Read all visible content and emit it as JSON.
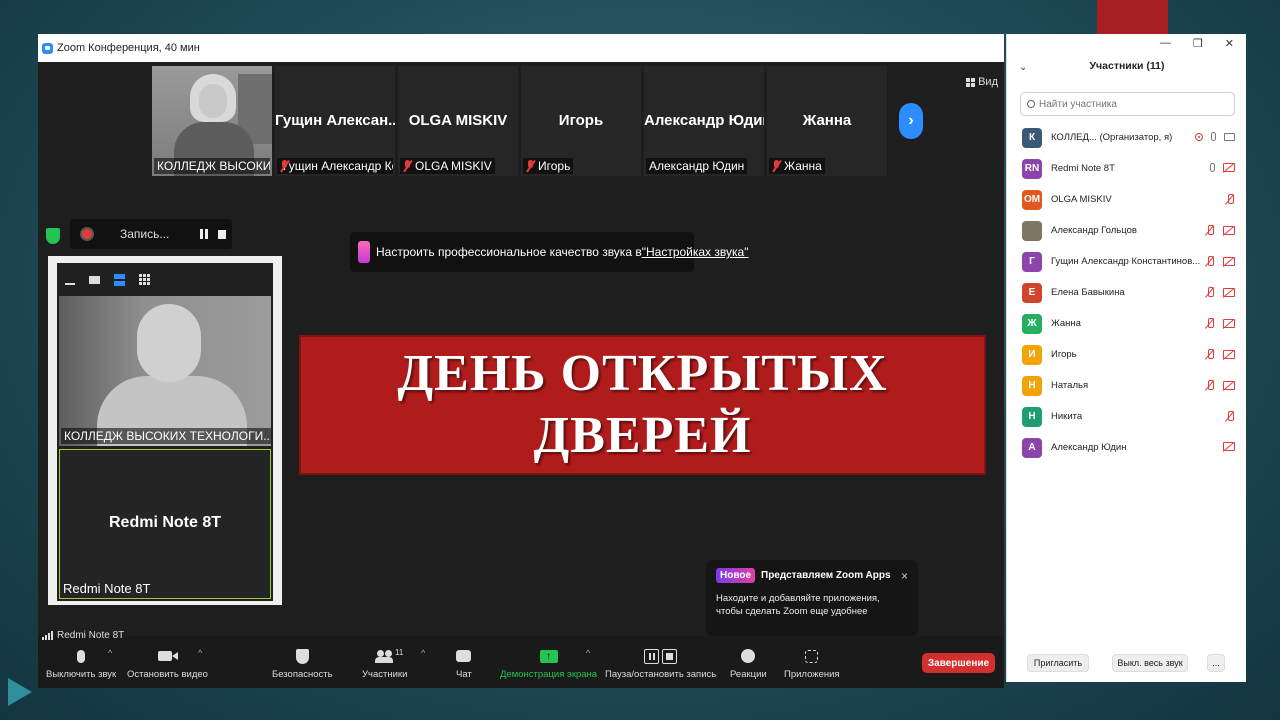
{
  "window": {
    "title": "Zoom Конференция, 40 мин"
  },
  "gallery": {
    "tiles": [
      {
        "label": "КОЛЛЕДЖ ВЫСОКИХ Т...",
        "center": "",
        "muted": false,
        "photo": true
      },
      {
        "label": "Гущин Александр Ко...",
        "center": "Гущин  Алексан...",
        "muted": true,
        "photo": false
      },
      {
        "label": "OLGA MISKIV",
        "center": "OLGA MISKIV",
        "muted": true,
        "photo": false
      },
      {
        "label": "Игорь",
        "center": "Игорь",
        "muted": true,
        "photo": false
      },
      {
        "label": "Александр Юдин",
        "center": "Александр Юдин",
        "muted": false,
        "photo": false
      },
      {
        "label": "Жанна",
        "center": "Жанна",
        "muted": true,
        "photo": false
      }
    ],
    "next_icon": "chevron-right-icon",
    "view_label": "Вид"
  },
  "recording": {
    "label": "Запись..."
  },
  "audio_tip": {
    "text": "Настроить профессиональное качество звука в ",
    "link": "\"Настройках звука\""
  },
  "self_view": {
    "video_label": "КОЛЛЕДЖ ВЫСОКИХ ТЕХНОЛОГИ...",
    "tile2_center": "Redmi Note 8T",
    "tile2_label": "Redmi Note 8T"
  },
  "slide": {
    "text": "ДЕНЬ  ОТКРЫТЫХ\nДВЕРЕЙ"
  },
  "apps_popup": {
    "badge": "Новое",
    "heading": "Представляем Zoom Apps",
    "body": "Находите и добавляйте приложения, чтобы сделать Zoom еще удобнее",
    "close": "×"
  },
  "network": {
    "label": "Redmi Note 8T"
  },
  "controls": {
    "mute": "Выключить звук",
    "video": "Остановить видео",
    "security": "Безопасность",
    "participants": "Участники",
    "participants_count": "11",
    "chat": "Чат",
    "share": "Демонстрация экрана",
    "record": "Пауза/остановить запись",
    "reactions": "Реакции",
    "apps": "Приложения",
    "end": "Завершение"
  },
  "panel": {
    "title": "Участники (11)",
    "search_placeholder": "Найти участника",
    "participants": [
      {
        "initials": "К",
        "color": "#3b5876",
        "name": "КОЛЛЕД...   (Организатор, я)",
        "status": "host"
      },
      {
        "initials": "RN",
        "color": "#8e44ad",
        "name": "Redmi Note 8T",
        "status": "mic-on-cam-off"
      },
      {
        "initials": "OM",
        "color": "#e0581f",
        "name": "OLGA MISKIV",
        "status": "muted-only"
      },
      {
        "initials": "",
        "color": "#7d7566",
        "name": "Александр Гольцов",
        "status": "muted-cam-off"
      },
      {
        "initials": "Г",
        "color": "#8e44ad",
        "name": "Гущин Александр Константинов...",
        "status": "muted-cam-off"
      },
      {
        "initials": "Е",
        "color": "#d0452b",
        "name": "Елена Бавыкина",
        "status": "muted-cam-off"
      },
      {
        "initials": "Ж",
        "color": "#27ae60",
        "name": "Жанна",
        "status": "muted-cam-off"
      },
      {
        "initials": "И",
        "color": "#f0a30a",
        "name": "Игорь",
        "status": "muted-cam-off"
      },
      {
        "initials": "Н",
        "color": "#f0a30a",
        "name": "Наталья",
        "status": "muted-cam-off"
      },
      {
        "initials": "Н",
        "color": "#1e9e73",
        "name": "Никита",
        "status": "muted-only"
      },
      {
        "initials": "А",
        "color": "#8e44ad",
        "name": "Александр Юдин",
        "status": "cam-off-only"
      }
    ],
    "invite": "Пригласить",
    "mute_all": "Выкл. весь звук",
    "more": "..."
  }
}
